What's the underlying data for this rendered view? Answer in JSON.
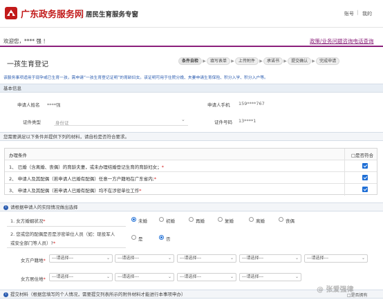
{
  "header": {
    "site_name": "广东政务服务网",
    "sub_title": "居民生育服务专窗",
    "nav_account": "账号",
    "nav_sep": "|",
    "nav_mine": "我的"
  },
  "welcome": {
    "text": "欢迎您，**** 强 ！",
    "consult_link": "政策/业务问题咨询电话查询"
  },
  "page": {
    "title": "一孩生育登记",
    "steps": [
      "条件自检",
      "填写表单",
      "上传附件",
      "承诺书",
      "提交确认",
      "完成申请"
    ],
    "step_arrow": "▶",
    "notice": "该服务事项适用于现孕或已生育一孩，需申请“一孩生育登记证明”的育龄妇女。该证明可用于住院分娩、夫妻申请生育保险、积分入学、积分入户等。"
  },
  "basic": {
    "section_title": "基本信息",
    "name_label": "申请人姓名",
    "name_value": "****强",
    "phone_label": "申请人手机",
    "phone_value": "159****767",
    "id_type_label": "证件类型",
    "id_type_value": "身份证",
    "id_no_label": "证件号码",
    "id_no_value": "13****1"
  },
  "conditions": {
    "section_note": "您需要满足以下条件并提供下列的材料，请自检是否符合要求。",
    "header_label": "办理条件",
    "header_check": "□是否符合",
    "rows": [
      {
        "text": "1、 已婚（含离婚、丧偶）的育龄夫妻，或未办理结婚登记生育的育龄妇女；",
        "mark": "*",
        "checked": true
      },
      {
        "text": "2、 申请人及其配偶（若申请人已婚有配偶）任意一方户籍地在广东省内;",
        "mark": "*",
        "checked": true
      },
      {
        "text": "3、 申请人及其配偶（若申请人已婚有配偶）均不在涉密单位工作",
        "mark": "*",
        "checked": true
      }
    ]
  },
  "choices": {
    "section_title": "请根据申请人的实际情况做出选择",
    "q1_label": "1. 女方婚姻状况",
    "q1_mark": "*",
    "q1_options": [
      "未婚",
      "初婚",
      "再婚",
      "复婚",
      "离婚",
      "丧偶"
    ],
    "q1_selected": "未婚",
    "q2_line1": "2. 您或您的配偶是否是涉密单位人员（如：现役军人",
    "q2_line2": "或安全部门等人员）?",
    "q2_mark": "*",
    "q2_options": [
      "是",
      "否"
    ],
    "q2_selected": "否",
    "hukou_label": "女方户籍地",
    "residence_label": "女方居住地",
    "field_mark": "*",
    "select_placeholder": "---请选择---",
    "chevron": "⌄"
  },
  "materials": {
    "info_icon": "i",
    "text": "提交材料（根据您填写的个人情况，需要提交列表所示的附件材料才能进行本事项申办）",
    "check": "□是否拥有"
  },
  "watermark": "@ 张爱强律",
  "colors": {
    "brand_red": "#c21a1a",
    "accent_purple": "#8a1f7a",
    "link_blue": "#2c5db0",
    "checkbox_blue": "#1f6fd6"
  }
}
